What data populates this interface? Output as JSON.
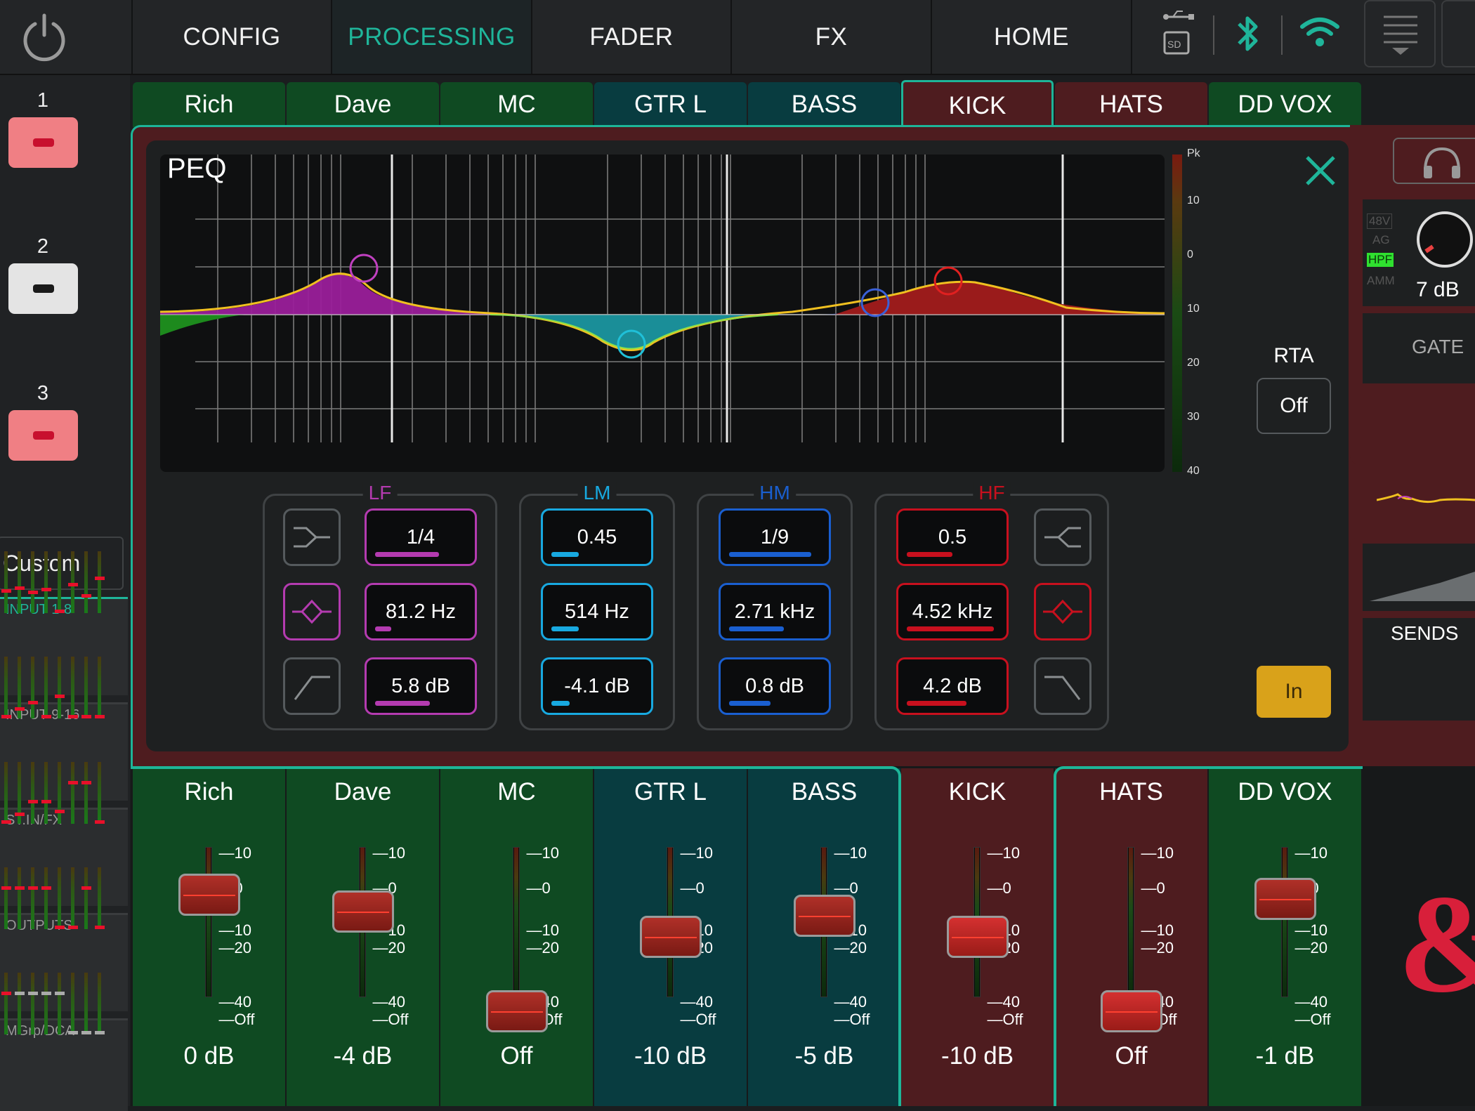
{
  "nav": {
    "tabs": [
      "CONFIG",
      "PROCESSING",
      "FADER",
      "FX",
      "HOME"
    ],
    "active": "PROCESSING"
  },
  "scenes": [
    {
      "number": "1",
      "state": "active"
    },
    {
      "number": "2",
      "state": "inactive"
    },
    {
      "number": "3",
      "state": "active"
    }
  ],
  "left": {
    "custom_label": "Custom",
    "banks": [
      "INPUT 1-8",
      "INPUT 9-16",
      "ST.IN/FX",
      "OUTPUTS",
      "MGrp/DCA"
    ]
  },
  "channel_tabs": [
    {
      "name": "Rich",
      "color": "green"
    },
    {
      "name": "Dave",
      "color": "green"
    },
    {
      "name": "MC",
      "color": "green"
    },
    {
      "name": "GTR L",
      "color": "teal"
    },
    {
      "name": "BASS",
      "color": "teal"
    },
    {
      "name": "KICK",
      "color": "red",
      "selected": true
    },
    {
      "name": "HATS",
      "color": "red"
    },
    {
      "name": "DD VOX",
      "color": "green"
    }
  ],
  "peq": {
    "title": "PEQ",
    "meter_labels": [
      "Pk",
      "10",
      "0",
      "10",
      "20",
      "30",
      "40"
    ],
    "rta_label": "RTA",
    "rta_value": "Off",
    "in_label": "In",
    "bands": [
      {
        "name": "LF",
        "color": "#b43bb0",
        "width": "1/4",
        "freq": "81.2 Hz",
        "gain": "5.8 dB",
        "width_level": 0.7,
        "freq_level": 0.18,
        "gain_level": 0.6
      },
      {
        "name": "LM",
        "color": "#18a9e0",
        "width": "0.45",
        "freq": "514 Hz",
        "gain": "-4.1 dB",
        "width_level": 0.3,
        "freq_level": 0.3,
        "gain_level": 0.2
      },
      {
        "name": "HM",
        "color": "#1a5fd0",
        "width": "1/9",
        "freq": "2.71 kHz",
        "gain": "0.8 dB",
        "width_level": 0.9,
        "freq_level": 0.6,
        "gain_level": 0.45
      },
      {
        "name": "HF",
        "color": "#c8101e",
        "width": "0.5",
        "freq": "4.52 kHz",
        "gain": "4.2 dB",
        "width_level": 0.5,
        "freq_level": 0.95,
        "gain_level": 0.65
      }
    ]
  },
  "right_panel": {
    "tags": [
      "48V",
      "AG",
      "HPF",
      "AMM"
    ],
    "gain": "7 dB",
    "gate_label": "GATE",
    "sends_label": "SENDS"
  },
  "faders": [
    {
      "name": "Rich",
      "value": "0 dB",
      "color": "green",
      "level_db": 0
    },
    {
      "name": "Dave",
      "value": "-4 dB",
      "color": "green",
      "level_db": -4
    },
    {
      "name": "MC",
      "value": "Off",
      "color": "green",
      "level_db": null
    },
    {
      "name": "GTR L",
      "value": "-10 dB",
      "color": "teal",
      "level_db": -10
    },
    {
      "name": "BASS",
      "value": "-5 dB",
      "color": "teal",
      "level_db": -5
    },
    {
      "name": "KICK",
      "value": "-10 dB",
      "color": "red",
      "level_db": -10
    },
    {
      "name": "HATS",
      "value": "Off",
      "color": "red",
      "level_db": null
    },
    {
      "name": "DD VOX",
      "value": "-1 dB",
      "color": "green",
      "level_db": -1
    }
  ],
  "fader_scale": [
    "10",
    "0",
    "10",
    "20",
    "40",
    "Off"
  ],
  "logo": "&",
  "colors": {
    "accent": "#1fb59a",
    "in_button": "#d9a21a",
    "red_channel": "#4e1c1f",
    "green_channel": "#0f4a22",
    "teal_channel": "#083c40"
  }
}
